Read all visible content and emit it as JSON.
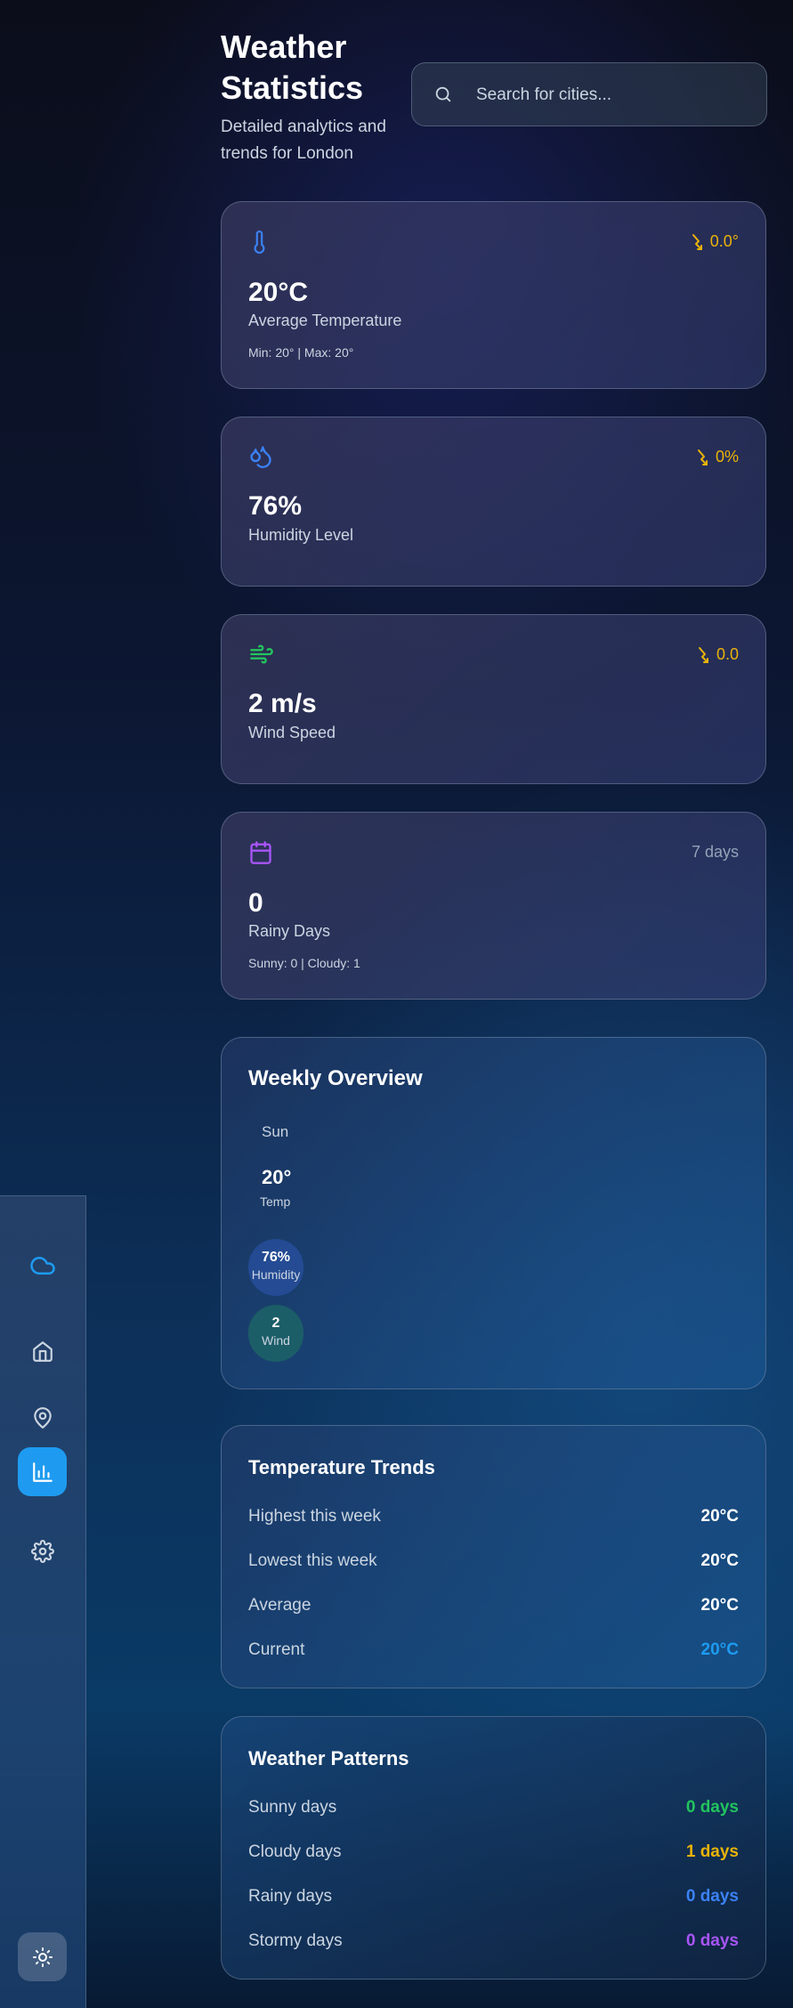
{
  "header": {
    "title": "Weather Statistics",
    "subtitle": "Detailed analytics and trends for London",
    "search_placeholder": "Search for cities..."
  },
  "sidebar": {
    "items": [
      {
        "name": "cloud-icon"
      },
      {
        "name": "home-icon"
      },
      {
        "name": "location-pin-icon"
      },
      {
        "name": "bar-chart-icon",
        "active": true
      },
      {
        "name": "gear-icon"
      },
      {
        "name": "sun-icon"
      }
    ]
  },
  "stats": {
    "temperature": {
      "value": "20°C",
      "label": "Average Temperature",
      "sub": "Min: 20° | Max: 20°",
      "trend": "0.0°"
    },
    "humidity": {
      "value": "76%",
      "label": "Humidity Level",
      "trend": "0%"
    },
    "wind": {
      "value": "2 m/s",
      "label": "Wind Speed",
      "trend": "0.0"
    },
    "rainy": {
      "value": "0",
      "label": "Rainy Days",
      "sub": "Sunny: 0 | Cloudy: 1",
      "period": "7 days"
    }
  },
  "weekly": {
    "title": "Weekly Overview",
    "day": "Sun",
    "temp": "20°",
    "temp_label": "Temp",
    "humidity": "76%",
    "humidity_label": "Humidity",
    "wind": "2",
    "wind_label": "Wind"
  },
  "trends": {
    "title": "Temperature Trends",
    "rows": [
      {
        "label": "Highest this week",
        "value": "20°C"
      },
      {
        "label": "Lowest this week",
        "value": "20°C"
      },
      {
        "label": "Average",
        "value": "20°C"
      },
      {
        "label": "Current",
        "value": "20°C"
      }
    ]
  },
  "patterns": {
    "title": "Weather Patterns",
    "rows": [
      {
        "label": "Sunny days",
        "value": "0 days"
      },
      {
        "label": "Cloudy days",
        "value": "1 days"
      },
      {
        "label": "Rainy days",
        "value": "0 days"
      },
      {
        "label": "Stormy days",
        "value": "0 days"
      }
    ]
  },
  "colors": {
    "accent": "#1e9bf0",
    "trend": "#eab308",
    "sunny": "#22c55e",
    "cloudy": "#eab308",
    "rainy": "#3b82f6",
    "stormy": "#a855f7"
  }
}
